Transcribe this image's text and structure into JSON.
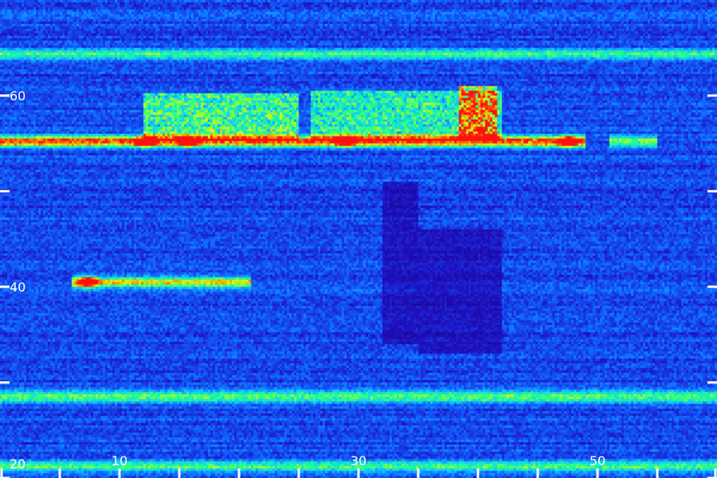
{
  "chart_data": {
    "type": "heatmap",
    "title": "",
    "xlabel": "",
    "ylabel": "",
    "xlim": [
      0,
      60
    ],
    "ylim": [
      20,
      70
    ],
    "x_ticks": [
      0,
      5,
      10,
      15,
      20,
      25,
      30,
      35,
      40,
      45,
      50,
      55,
      60
    ],
    "x_tick_labels": [
      {
        "value": 10,
        "label": "10"
      },
      {
        "value": 30,
        "label": "30"
      },
      {
        "value": 50,
        "label": "50"
      }
    ],
    "y_ticks": [
      20,
      30,
      40,
      50,
      60
    ],
    "y_tick_labels": [
      {
        "value": 20,
        "label": "20"
      },
      {
        "value": 40,
        "label": "40"
      },
      {
        "value": 60,
        "label": "60"
      }
    ],
    "grid": false,
    "colormap": [
      "#100060",
      "#2010c0",
      "#1060ff",
      "#10c8ff",
      "#20ff90",
      "#d0ff10",
      "#ff8000",
      "#ff1010"
    ],
    "background_color": "#1a0a6e",
    "bands": [
      {
        "y": 64.3,
        "x_start": 0,
        "x_end": 60,
        "intensity": 0.35
      },
      {
        "y": 55.2,
        "x_start": 0,
        "x_end": 49,
        "intensity": 0.78
      },
      {
        "y": 55.2,
        "x_start": 51,
        "x_end": 55,
        "intensity": 0.45
      },
      {
        "y": 40.5,
        "x_start": 6,
        "x_end": 21,
        "intensity": 0.55
      },
      {
        "y": 28.5,
        "x_start": 0,
        "x_end": 60,
        "intensity": 0.42
      },
      {
        "y": 21.2,
        "x_start": 0,
        "x_end": 60,
        "intensity": 0.4
      }
    ],
    "hotspots": [
      {
        "x": 7.3,
        "y": 40.5,
        "intensity": 1.0
      },
      {
        "x": 12.2,
        "y": 55.2,
        "intensity": 0.92
      },
      {
        "x": 29.0,
        "y": 55.2,
        "intensity": 0.9
      },
      {
        "x": 47.6,
        "y": 55.2,
        "intensity": 0.95
      },
      {
        "x": 15.7,
        "y": 55.2,
        "intensity": 0.85
      }
    ],
    "plumes": [
      {
        "x_start": 12,
        "x_end": 25,
        "y_top": 60.2,
        "intensity": 0.45
      },
      {
        "x_start": 26,
        "x_end": 42,
        "y_top": 60.5,
        "intensity": 0.4
      },
      {
        "x_start": 38.5,
        "x_end": 41.5,
        "y_top": 61.0,
        "intensity": 0.6
      }
    ],
    "dark_regions": [
      {
        "x_start": 32,
        "x_end": 35,
        "y_bottom": 34,
        "y_top": 51
      },
      {
        "x_start": 35,
        "x_end": 42,
        "y_bottom": 33,
        "y_top": 46
      }
    ]
  }
}
